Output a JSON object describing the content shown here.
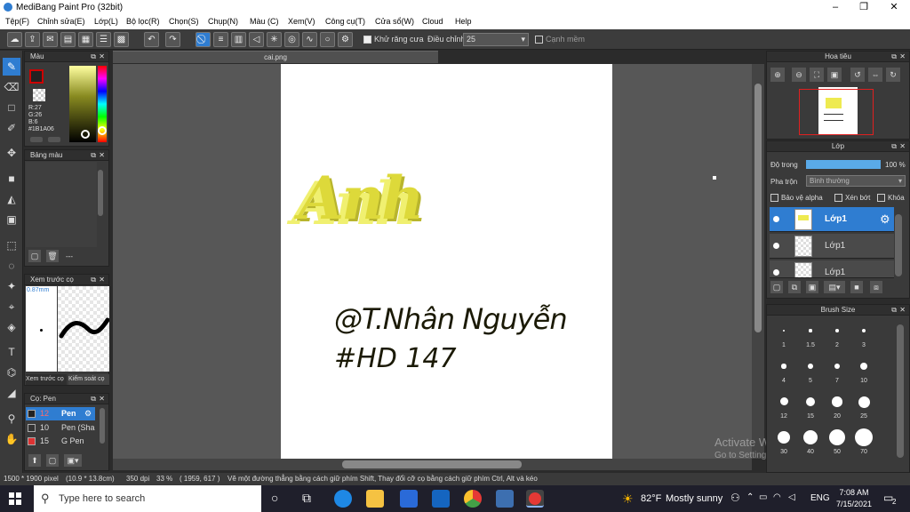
{
  "window": {
    "title": "MediBang Paint Pro (32bit)",
    "buttons": [
      "–",
      "❐",
      "✕"
    ]
  },
  "menu": [
    "Tệp(F)",
    "Chỉnh sửa(E)",
    "Lớp(L)",
    "Bộ lọc(R)",
    "Chọn(S)",
    "Chụp(N)",
    "Màu (C)",
    "Xem(V)",
    "Công cụ(T)",
    "Cửa sổ(W)",
    "Cloud",
    "Help"
  ],
  "toolbar": {
    "antialias_label": "Khử răng cưa",
    "adjust_label": "Điều chỉnh",
    "adjust_value": "25",
    "sharp_edge_label": "Cạnh mềm"
  },
  "color_panel": {
    "title": "Màu",
    "r": "R:27",
    "g": "G:26",
    "b": "B:6",
    "hex": "#1B1A06",
    "fg": "#cc0000"
  },
  "palette_panel": {
    "title": "Bảng màu",
    "footer": "---"
  },
  "preview_panel": {
    "title": "Xem trước cọ",
    "size": "0.87mm",
    "tab1": "Xem trước cọ",
    "tab2": "Kiểm soát cọ"
  },
  "brush_panel": {
    "title": "Cọ: Pen",
    "items": [
      {
        "size": "12",
        "name": "Pen"
      },
      {
        "size": "10",
        "name": "Pen (Sha"
      },
      {
        "size": "15",
        "name": "G Pen"
      }
    ]
  },
  "document": {
    "tab": "cai.png",
    "art_title": "Anh",
    "line1": "@T.Nhân Nguyễn",
    "line2": "#HD 147"
  },
  "navigator": {
    "title": "Hoa tiêu"
  },
  "layer_panel": {
    "title": "Lớp",
    "opacity_label": "Độ trong",
    "opacity_value": "100 %",
    "opacity_pct": 100,
    "blend_label": "Pha trộn",
    "blend_value": "Bình thường",
    "protect_alpha": "Bảo vệ alpha",
    "clipping": "Xén bớt",
    "lock": "Khóa",
    "layers": [
      "Lớp1",
      "Lớp1",
      "Lớp1"
    ]
  },
  "brush_size_panel": {
    "title": "Brush Size",
    "sizes": [
      "1",
      "1.5",
      "2",
      "3",
      "4",
      "5",
      "7",
      "10",
      "12",
      "15",
      "20",
      "25",
      "30",
      "40",
      "50",
      "70"
    ]
  },
  "status": {
    "size": "1500 * 1900 pixel",
    "mm": "(10.9 * 13.8cm)",
    "dpi": "350 dpi",
    "zoom": "33 %",
    "coords": "( 1959, 617 )",
    "hint": "Vẽ một đường thẳng bằng cách giữ phím Shift, Thay đổi cỡ cọ bằng cách giữ phím Ctrl, Alt và kéo"
  },
  "watermark": {
    "line1": "Activate Windows",
    "line2": "Go to Settings to activate Windows."
  },
  "taskbar": {
    "search": "Type here to search",
    "temp": "82°F",
    "weather": "Mostly sunny",
    "lang": "ENG",
    "time": "7:08 AM",
    "date": "7/15/2021",
    "notif": "2"
  }
}
